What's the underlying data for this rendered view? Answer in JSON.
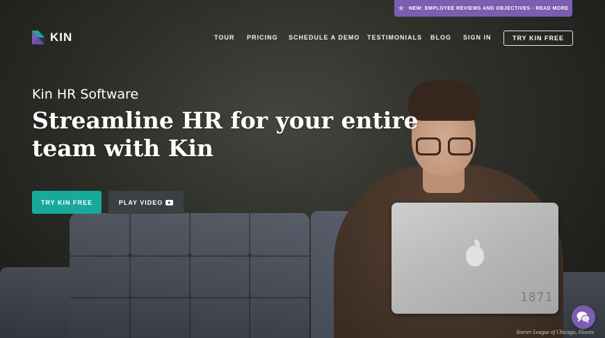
{
  "announcement": {
    "text": "NEW: EMPLOYEE REVIEWS AND OBJECTIVES - READ MORE",
    "icon": "star-icon"
  },
  "brand": {
    "name": "KIN",
    "logo_colors": [
      "#1aa99c",
      "#7d5db0",
      "#25365a"
    ]
  },
  "nav": {
    "links": [
      "TOUR",
      "PRICING",
      "SCHEDULE A DEMO",
      "TESTIMONIALS",
      "BLOG",
      "SIGN IN"
    ],
    "cta": "TRY KIN FREE"
  },
  "hero": {
    "eyebrow": "Kin HR Software",
    "headline": "Streamline HR for your entire team with Kin",
    "primary_button": "TRY KIN FREE",
    "secondary_button": "PLAY VIDEO",
    "secondary_icon": "play-icon"
  },
  "photo": {
    "laptop_sticker": "1871",
    "caption": "Starter League of Chicago, Illinois"
  },
  "chat": {
    "icon": "chat-bubbles-icon"
  },
  "colors": {
    "accent_teal": "#19a99c",
    "accent_purple": "#7d5db0",
    "button_dark": "#3b4043"
  }
}
